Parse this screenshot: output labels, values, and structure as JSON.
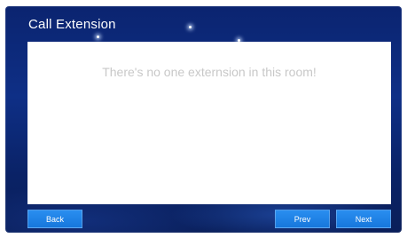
{
  "window": {
    "title": "Call Extension"
  },
  "panel": {
    "message": "There's no one externsion in this room!"
  },
  "footer": {
    "back_label": "Back",
    "prev_label": "Prev",
    "next_label": "Next"
  },
  "colors": {
    "background": "#0e2f86",
    "button": "#1f84e8",
    "panel": "#ffffff",
    "message_text": "#c8c8c8"
  }
}
